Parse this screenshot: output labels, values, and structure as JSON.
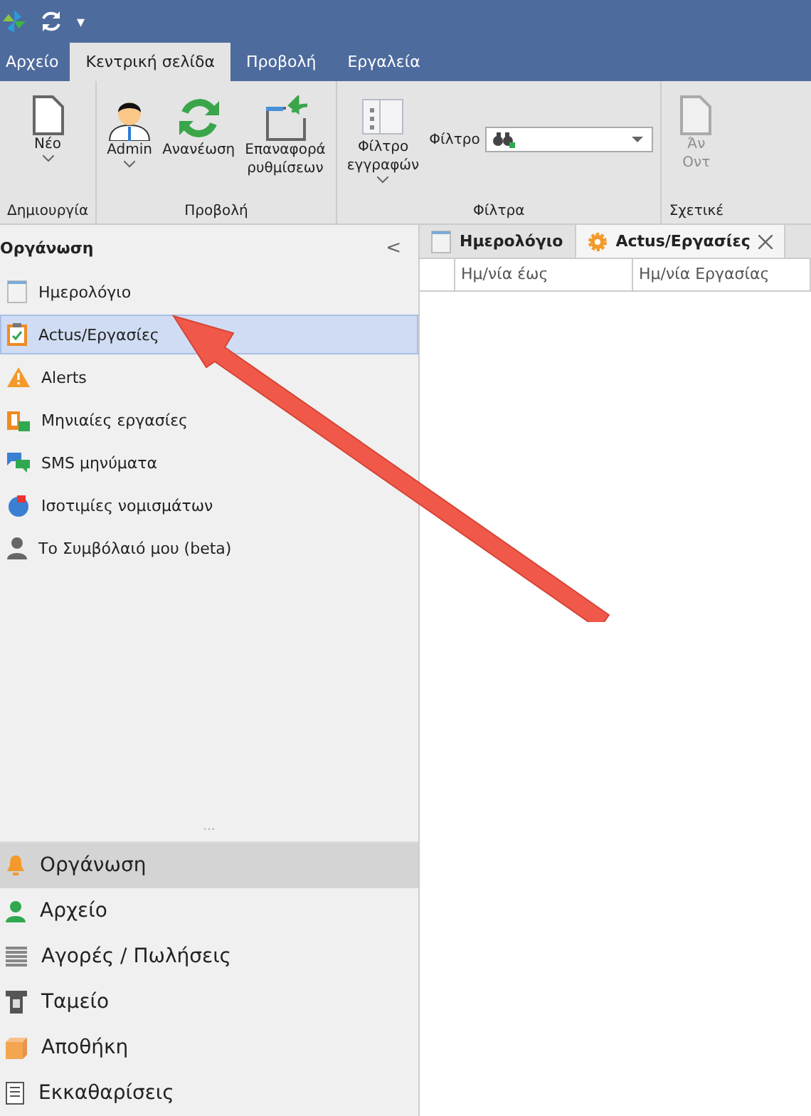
{
  "quick_access": {
    "dropdown": "▾"
  },
  "ribbon_tabs": [
    {
      "label": "Αρχείο",
      "selected": false,
      "kind": "file"
    },
    {
      "label": "Κεντρική σελίδα",
      "selected": true,
      "kind": "tab"
    },
    {
      "label": "Προβολή",
      "selected": false,
      "kind": "tab"
    },
    {
      "label": "Εργαλεία",
      "selected": false,
      "kind": "tab"
    }
  ],
  "ribbon_groups": [
    {
      "caption": "Δημιουργία",
      "buttons": [
        {
          "lines": [
            "Νέο"
          ],
          "kind": "page",
          "dropdown": true,
          "disabled": false
        }
      ]
    },
    {
      "caption": "Προβολή",
      "buttons": [
        {
          "lines": [
            "Admin"
          ],
          "kind": "user",
          "dropdown": true,
          "disabled": false
        },
        {
          "lines": [
            "Ανανέωση"
          ],
          "kind": "refresh",
          "dropdown": false,
          "disabled": false
        },
        {
          "lines": [
            "Επαναφορά",
            "ρυθμίσεων"
          ],
          "kind": "reset",
          "dropdown": false,
          "disabled": false
        }
      ]
    },
    {
      "caption": "Φίλτρα",
      "buttons": [
        {
          "lines": [
            "Φίλτρο",
            "εγγραφών"
          ],
          "kind": "filter",
          "dropdown": true,
          "disabled": false
        }
      ],
      "field": {
        "label": "Φίλτρο"
      }
    },
    {
      "caption": "Σχετικέ",
      "buttons": [
        {
          "lines": [
            "Άν",
            "Οντ"
          ],
          "kind": "page",
          "dropdown": false,
          "disabled": true
        }
      ]
    }
  ],
  "sidebar": {
    "title": "Οργάνωση",
    "collapse": "<",
    "items": [
      {
        "label": "Ημερολόγιο",
        "kind": "calendar",
        "selected": false
      },
      {
        "label": "Actus/Εργασίες",
        "kind": "clipboard",
        "selected": true
      },
      {
        "label": "Alerts",
        "kind": "warning",
        "selected": false
      },
      {
        "label": "Μηνιαίες εργασίες",
        "kind": "monthly",
        "selected": false
      },
      {
        "label": "SMS μηνύματα",
        "kind": "chat",
        "selected": false
      },
      {
        "label": "Ισοτιμίες νομισμάτων",
        "kind": "globe",
        "selected": false
      },
      {
        "label": "Το Συμβόλαιό μου (beta)",
        "kind": "person",
        "selected": false
      }
    ],
    "splitter": "...",
    "nav": [
      {
        "label": "Οργάνωση",
        "kind": "bell",
        "selected": true
      },
      {
        "label": "Αρχείο",
        "kind": "contact",
        "selected": false
      },
      {
        "label": "Αγορές / Πωλήσεις",
        "kind": "lines",
        "selected": false
      },
      {
        "label": "Ταμείο",
        "kind": "register",
        "selected": false
      },
      {
        "label": "Αποθήκη",
        "kind": "box",
        "selected": false
      },
      {
        "label": "Εκκαθαρίσεις",
        "kind": "document",
        "selected": false
      }
    ]
  },
  "doc_tabs": [
    {
      "label": "Ημερολόγιο",
      "kind": "calendar",
      "selected": false,
      "closable": false
    },
    {
      "label": "Actus/Εργασίες",
      "kind": "gear",
      "selected": true,
      "closable": true
    }
  ],
  "grid": {
    "columns": [
      "Ημ/νία έως",
      "Ημ/νία Εργασίας"
    ]
  }
}
